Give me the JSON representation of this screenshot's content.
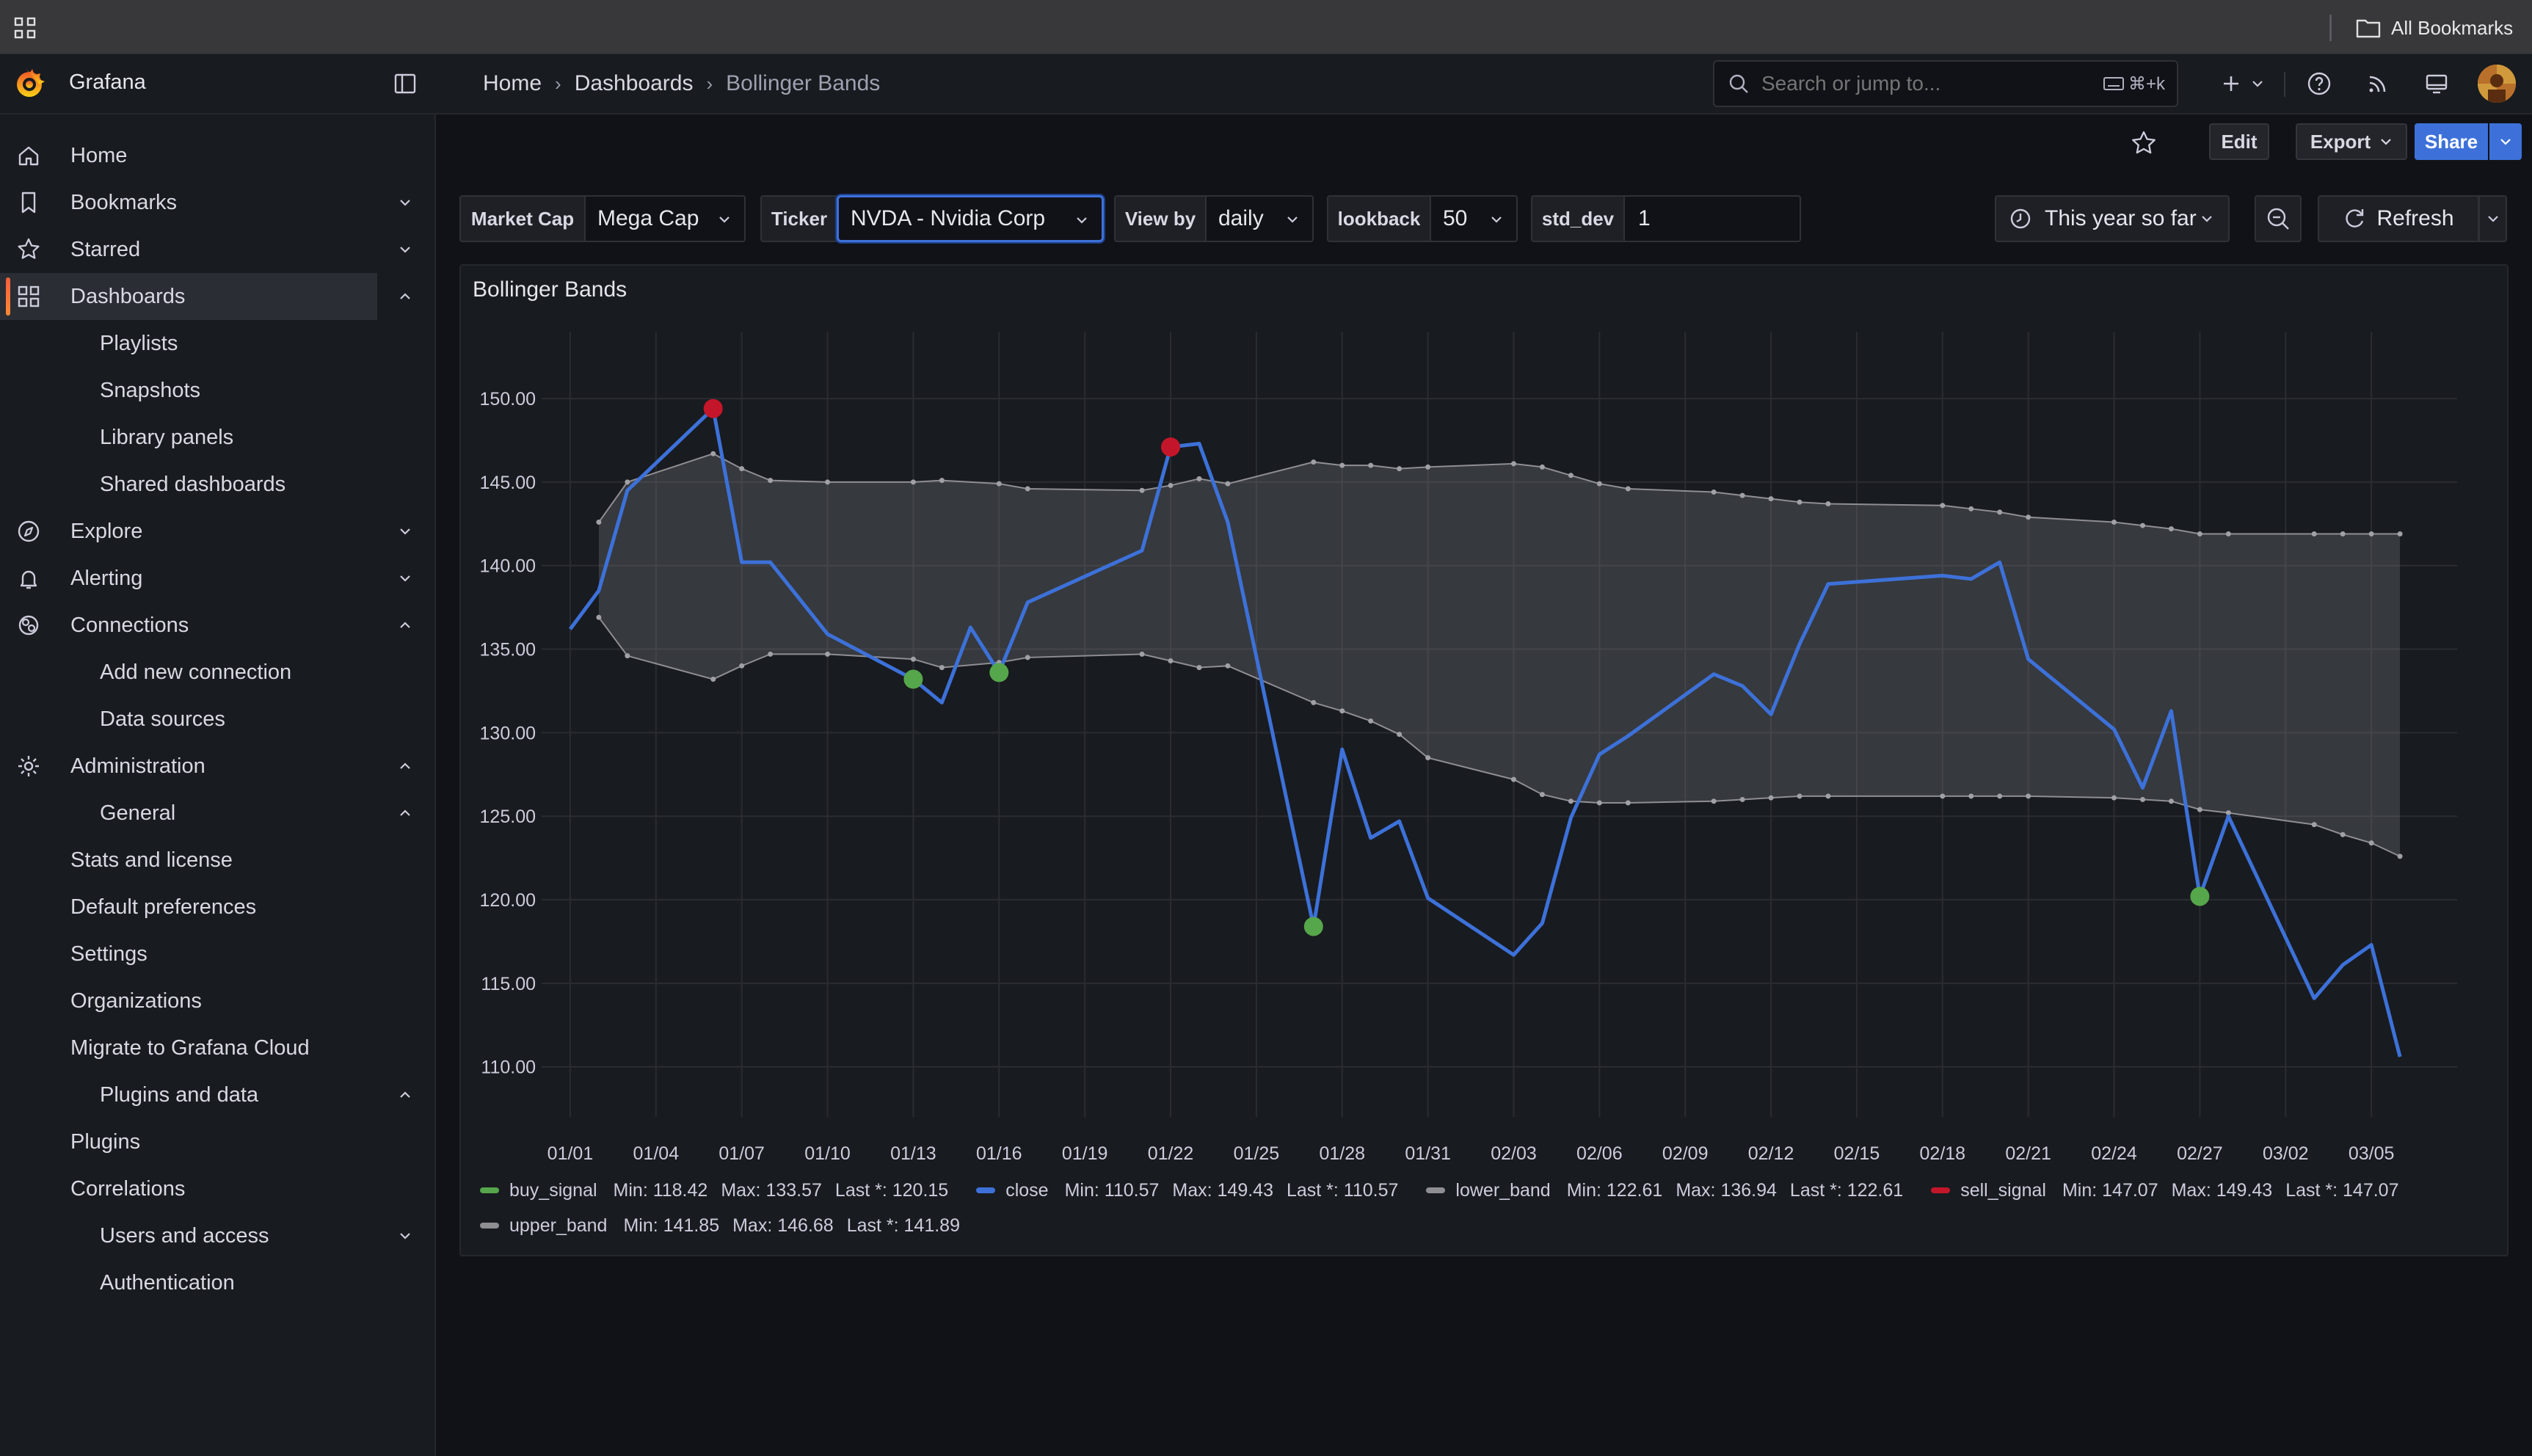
{
  "browser": {
    "bookmarks_label": "All Bookmarks"
  },
  "header": {
    "app_name": "Grafana",
    "breadcrumb": [
      "Home",
      "Dashboards",
      "Bollinger Bands"
    ],
    "search_placeholder": "Search or jump to...",
    "search_shortcut": "⌘+k"
  },
  "sidebar": {
    "items": [
      {
        "label": "Home",
        "icon": "home-icon",
        "chevron": ""
      },
      {
        "label": "Bookmarks",
        "icon": "bookmark-icon",
        "chevron": "down"
      },
      {
        "label": "Starred",
        "icon": "star-icon",
        "chevron": "down"
      },
      {
        "label": "Dashboards",
        "icon": "apps-icon",
        "chevron": "up",
        "active": true
      },
      {
        "label": "Playlists"
      },
      {
        "label": "Snapshots"
      },
      {
        "label": "Library panels"
      },
      {
        "label": "Shared dashboards"
      },
      {
        "label": "Explore",
        "icon": "compass-icon",
        "chevron": "down"
      },
      {
        "label": "Alerting",
        "icon": "bell-icon",
        "chevron": "down"
      },
      {
        "label": "Connections",
        "icon": "connections-icon",
        "chevron": "up"
      },
      {
        "label": "Add new connection"
      },
      {
        "label": "Data sources"
      },
      {
        "label": "Administration",
        "icon": "cog-icon",
        "chevron": "up"
      },
      {
        "label": "General",
        "chevron": "up"
      },
      {
        "label": "Stats and license"
      },
      {
        "label": "Default preferences"
      },
      {
        "label": "Settings"
      },
      {
        "label": "Organizations"
      },
      {
        "label": "Migrate to Grafana Cloud"
      },
      {
        "label": "Plugins and data",
        "chevron": "up"
      },
      {
        "label": "Plugins"
      },
      {
        "label": "Correlations"
      },
      {
        "label": "Users and access",
        "chevron": "down"
      },
      {
        "label": "Authentication"
      }
    ]
  },
  "toolbar": {
    "edit_label": "Edit",
    "export_label": "Export",
    "share_label": "Share"
  },
  "variables": {
    "market_cap": {
      "label": "Market Cap",
      "value": "Mega Cap"
    },
    "ticker": {
      "label": "Ticker",
      "value": "NVDA - Nvidia Corp"
    },
    "view_by": {
      "label": "View by",
      "value": "daily"
    },
    "lookback": {
      "label": "lookback",
      "value": "50"
    },
    "std_dev": {
      "label": "std_dev",
      "value": "1"
    }
  },
  "time_picker": {
    "label": "This year so far",
    "refresh_label": "Refresh"
  },
  "panel": {
    "title": "Bollinger Bands"
  },
  "legend": [
    {
      "name": "buy_signal",
      "color": "#56a64b",
      "min": "Min: 118.42",
      "max": "Max: 133.57",
      "last": "Last *: 120.15"
    },
    {
      "name": "close",
      "color": "#3d71d9",
      "min": "Min: 110.57",
      "max": "Max: 149.43",
      "last": "Last *: 110.57"
    },
    {
      "name": "lower_band",
      "color": "#8e8e93",
      "min": "Min: 122.61",
      "max": "Max: 136.94",
      "last": "Last *: 122.61"
    },
    {
      "name": "sell_signal",
      "color": "#c4162a",
      "min": "Min: 147.07",
      "max": "Max: 149.43",
      "last": "Last *: 147.07"
    },
    {
      "name": "upper_band",
      "color": "#8e8e93",
      "min": "Min: 141.85",
      "max": "Max: 146.68",
      "last": "Last *: 141.89"
    }
  ],
  "chart_data": {
    "type": "line",
    "title": "Bollinger Bands",
    "ylim": [
      107,
      154
    ],
    "y_ticks": [
      "110.00",
      "115.00",
      "120.00",
      "125.00",
      "130.00",
      "135.00",
      "140.00",
      "145.00",
      "150.00"
    ],
    "x_ticks": [
      "01/01",
      "01/04",
      "01/07",
      "01/10",
      "01/13",
      "01/16",
      "01/19",
      "01/22",
      "01/25",
      "01/28",
      "01/31",
      "02/03",
      "02/06",
      "02/09",
      "02/12",
      "02/15",
      "02/18",
      "02/21",
      "02/24",
      "02/27",
      "03/02",
      "03/05"
    ],
    "x_range_days": [
      -1,
      66
    ],
    "grid": true,
    "series": [
      {
        "name": "close",
        "color": "#3d71d9",
        "points": [
          [
            0,
            136.2
          ],
          [
            1,
            138.5
          ],
          [
            2,
            144.5
          ],
          [
            5,
            149.4
          ],
          [
            6,
            140.2
          ],
          [
            7,
            140.2
          ],
          [
            9,
            135.9
          ],
          [
            12,
            133.2
          ],
          [
            13,
            131.8
          ],
          [
            14,
            136.3
          ],
          [
            15,
            133.6
          ],
          [
            16,
            137.8
          ],
          [
            20,
            140.9
          ],
          [
            21,
            147.1
          ],
          [
            22,
            147.3
          ],
          [
            23,
            142.6
          ],
          [
            26,
            118.4
          ],
          [
            27,
            129.0
          ],
          [
            28,
            123.7
          ],
          [
            29,
            124.7
          ],
          [
            30,
            120.1
          ],
          [
            33,
            116.7
          ],
          [
            34,
            118.6
          ],
          [
            35,
            124.9
          ],
          [
            36,
            128.7
          ],
          [
            37,
            129.8
          ],
          [
            40,
            133.5
          ],
          [
            41,
            132.8
          ],
          [
            42,
            131.1
          ],
          [
            43,
            135.3
          ],
          [
            44,
            138.9
          ],
          [
            48,
            139.4
          ],
          [
            49,
            139.2
          ],
          [
            50,
            140.2
          ],
          [
            51,
            134.4
          ],
          [
            54,
            130.2
          ],
          [
            55,
            126.7
          ],
          [
            56,
            131.3
          ],
          [
            57,
            120.2
          ],
          [
            58,
            125.0
          ],
          [
            61,
            114.1
          ],
          [
            62,
            116.1
          ],
          [
            63,
            117.3
          ],
          [
            64,
            110.6
          ]
        ]
      },
      {
        "name": "upper_band",
        "color": "#8e8e93",
        "points": [
          [
            1,
            142.6
          ],
          [
            2,
            145.0
          ],
          [
            5,
            146.7
          ],
          [
            6,
            145.8
          ],
          [
            7,
            145.1
          ],
          [
            9,
            145.0
          ],
          [
            12,
            145.0
          ],
          [
            13,
            145.1
          ],
          [
            15,
            144.9
          ],
          [
            16,
            144.6
          ],
          [
            20,
            144.5
          ],
          [
            21,
            144.8
          ],
          [
            22,
            145.2
          ],
          [
            23,
            144.9
          ],
          [
            26,
            146.2
          ],
          [
            27,
            146.0
          ],
          [
            28,
            146.0
          ],
          [
            29,
            145.8
          ],
          [
            30,
            145.9
          ],
          [
            33,
            146.1
          ],
          [
            34,
            145.9
          ],
          [
            35,
            145.4
          ],
          [
            36,
            144.9
          ],
          [
            37,
            144.6
          ],
          [
            40,
            144.4
          ],
          [
            41,
            144.2
          ],
          [
            42,
            144.0
          ],
          [
            43,
            143.8
          ],
          [
            44,
            143.7
          ],
          [
            48,
            143.6
          ],
          [
            49,
            143.4
          ],
          [
            50,
            143.2
          ],
          [
            51,
            142.9
          ],
          [
            54,
            142.6
          ],
          [
            55,
            142.4
          ],
          [
            56,
            142.2
          ],
          [
            57,
            141.9
          ],
          [
            58,
            141.9
          ],
          [
            61,
            141.9
          ],
          [
            62,
            141.9
          ],
          [
            63,
            141.9
          ],
          [
            64,
            141.9
          ]
        ]
      },
      {
        "name": "lower_band",
        "color": "#8e8e93",
        "points": [
          [
            1,
            136.9
          ],
          [
            2,
            134.6
          ],
          [
            5,
            133.2
          ],
          [
            6,
            134.0
          ],
          [
            7,
            134.7
          ],
          [
            9,
            134.7
          ],
          [
            12,
            134.4
          ],
          [
            13,
            133.9
          ],
          [
            15,
            134.2
          ],
          [
            16,
            134.5
          ],
          [
            20,
            134.7
          ],
          [
            21,
            134.3
          ],
          [
            22,
            133.9
          ],
          [
            23,
            134.0
          ],
          [
            26,
            131.8
          ],
          [
            27,
            131.3
          ],
          [
            28,
            130.7
          ],
          [
            29,
            129.9
          ],
          [
            30,
            128.5
          ],
          [
            33,
            127.2
          ],
          [
            34,
            126.3
          ],
          [
            35,
            125.9
          ],
          [
            36,
            125.8
          ],
          [
            37,
            125.8
          ],
          [
            40,
            125.9
          ],
          [
            41,
            126.0
          ],
          [
            42,
            126.1
          ],
          [
            43,
            126.2
          ],
          [
            44,
            126.2
          ],
          [
            48,
            126.2
          ],
          [
            49,
            126.2
          ],
          [
            50,
            126.2
          ],
          [
            51,
            126.2
          ],
          [
            54,
            126.1
          ],
          [
            55,
            126.0
          ],
          [
            56,
            125.9
          ],
          [
            57,
            125.4
          ],
          [
            58,
            125.2
          ],
          [
            61,
            124.5
          ],
          [
            62,
            123.9
          ],
          [
            63,
            123.4
          ],
          [
            64,
            122.6
          ]
        ]
      },
      {
        "name": "buy_signal",
        "color": "#56a64b",
        "points": [
          [
            12,
            133.2
          ],
          [
            15,
            133.6
          ],
          [
            26,
            118.4
          ],
          [
            57,
            120.2
          ]
        ]
      },
      {
        "name": "sell_signal",
        "color": "#c4162a",
        "points": [
          [
            5,
            149.4
          ],
          [
            21,
            147.1
          ]
        ]
      }
    ]
  }
}
